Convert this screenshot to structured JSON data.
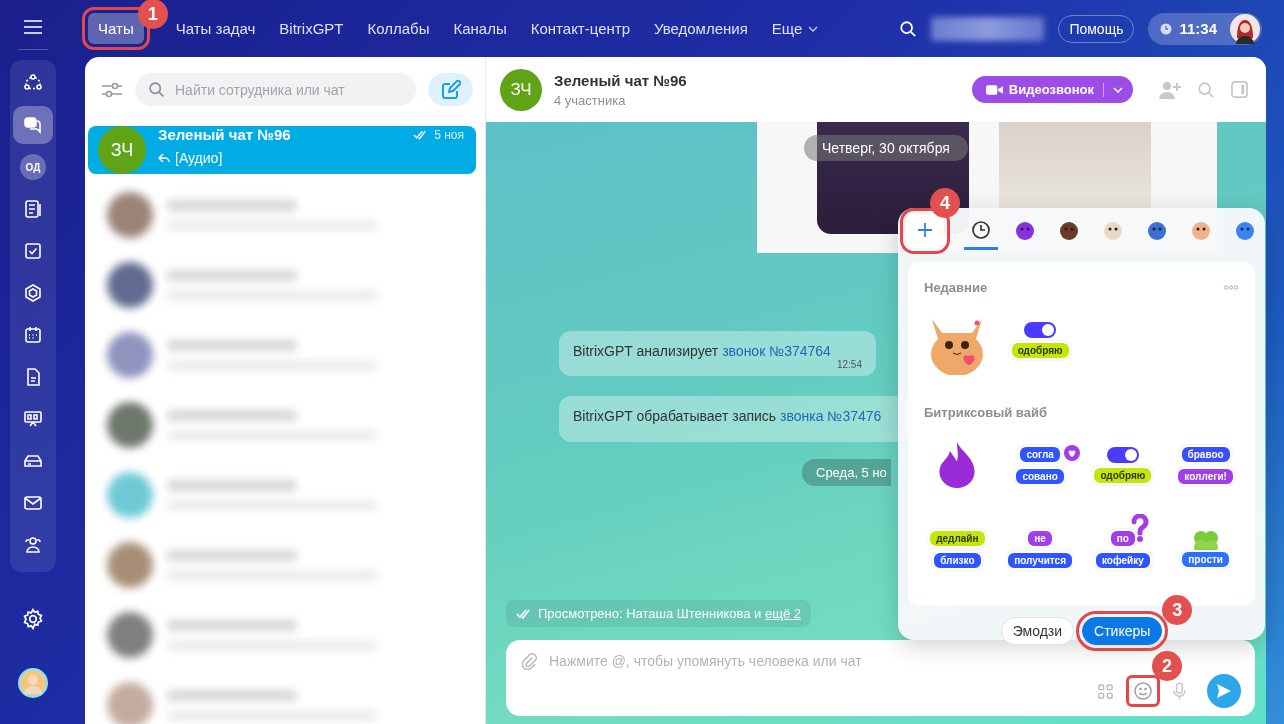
{
  "sidebar": {
    "items": [
      {
        "kind": "icon",
        "selected": false
      },
      {
        "kind": "icon",
        "selected": true
      },
      {
        "kind": "initials",
        "text": "ОД",
        "selected": false
      },
      {
        "kind": "icon",
        "selected": false
      },
      {
        "kind": "icon",
        "selected": false
      },
      {
        "kind": "icon",
        "selected": false
      },
      {
        "kind": "icon",
        "selected": false
      },
      {
        "kind": "icon",
        "selected": false
      },
      {
        "kind": "icon",
        "selected": false
      },
      {
        "kind": "icon",
        "selected": false
      },
      {
        "kind": "icon",
        "selected": false
      },
      {
        "kind": "icon",
        "selected": false
      }
    ]
  },
  "nav": {
    "tabs": [
      {
        "label": "Чаты",
        "selected": true,
        "callout": "1"
      },
      {
        "label": "Чаты задач",
        "selected": false
      },
      {
        "label": "BitrixGPT",
        "selected": false
      },
      {
        "label": "Коллабы",
        "selected": false
      },
      {
        "label": "Каналы",
        "selected": false
      },
      {
        "label": "Контакт-центр",
        "selected": false
      },
      {
        "label": "Уведомления",
        "selected": false
      },
      {
        "label": "Еще",
        "selected": false,
        "dropdown": true
      }
    ],
    "help_button": "Помощь",
    "time": "11:34"
  },
  "chat_list": {
    "search": {
      "placeholder": "Найти сотрудника или чат"
    },
    "chats": [
      {
        "initials": "ЗЧ",
        "name": "Зеленый чат №96",
        "preview": "[Аудио]",
        "date": "5 ноя",
        "read": true,
        "selected": true
      }
    ]
  },
  "chat": {
    "initials": "ЗЧ",
    "title": "Зеленый чат №96",
    "subtitle": "4 участника",
    "video_button": "Видеозвонок",
    "sticky_date": "Четверг, 30 октября",
    "feed": [
      {
        "kind": "message",
        "text": "BitrixGPT анализирует ",
        "link": "звонок №374764",
        "time": "12:54"
      },
      {
        "kind": "message",
        "text": "BitrixGPT обрабатывает запись ",
        "link": "звонка №37476"
      },
      {
        "kind": "date",
        "text": "Среда, 5 но"
      }
    ],
    "seen": {
      "text": "Просмотрено: Наташа Штенникова и ",
      "link": "ещё 2"
    },
    "input": {
      "placeholder": "Нажмите @, чтобы упомянуть человека или чат",
      "smile_callout": "2"
    }
  },
  "sticker_picker": {
    "packs": [
      {
        "kind": "add",
        "selected": false,
        "callout": "4"
      },
      {
        "kind": "recent",
        "selected": true
      },
      {
        "kind": "sticker",
        "selected": false
      },
      {
        "kind": "sticker",
        "selected": false
      },
      {
        "kind": "sticker",
        "selected": false
      },
      {
        "kind": "sticker",
        "selected": false
      },
      {
        "kind": "sticker",
        "selected": false
      },
      {
        "kind": "sticker",
        "selected": false
      }
    ],
    "sections": [
      {
        "title": "Недавние",
        "stickers": [
          {
            "kind": "cat"
          },
          {
            "kind": "toggle",
            "lines": [
              {
                "text": "одобряю",
                "color": "#c5e60a"
              }
            ]
          }
        ]
      },
      {
        "title": "Битриксовый вайб",
        "stickers": [
          {
            "kind": "flame"
          },
          {
            "kind": "heart",
            "lines": [
              {
                "text": "согла",
                "color": "#2e55ff"
              },
              {
                "text": "совано",
                "color": "#2e55ff"
              }
            ]
          },
          {
            "kind": "toggle",
            "lines": [
              {
                "text": "одобряю",
                "color": "#c5e60a"
              }
            ]
          },
          {
            "kind": "plain",
            "lines": [
              {
                "text": "бравоо",
                "color": "#3a4dff"
              },
              {
                "text": "коллеги!",
                "color": "#a23ee8"
              }
            ]
          },
          {
            "kind": "plain",
            "lines": [
              {
                "text": "дедлайн",
                "color": "#c5e60a"
              },
              {
                "text": "близко",
                "color": "#2e55ff"
              }
            ]
          },
          {
            "kind": "plain",
            "lines": [
              {
                "text": "не",
                "color": "#a23ee8"
              },
              {
                "text": "получится",
                "color": "#2e55ff"
              }
            ]
          },
          {
            "kind": "question",
            "lines": [
              {
                "text": "по",
                "color": "#a23ee8"
              },
              {
                "text": "кофейку",
                "color": "#2e55ff"
              }
            ]
          },
          {
            "kind": "clover",
            "lines": [
              {
                "text": "прости",
                "color": "#2e70ff"
              }
            ]
          }
        ]
      }
    ],
    "modes": [
      {
        "label": "Эмодзи",
        "selected": false
      },
      {
        "label": "Стикеры",
        "selected": true,
        "callout": "3"
      }
    ]
  }
}
